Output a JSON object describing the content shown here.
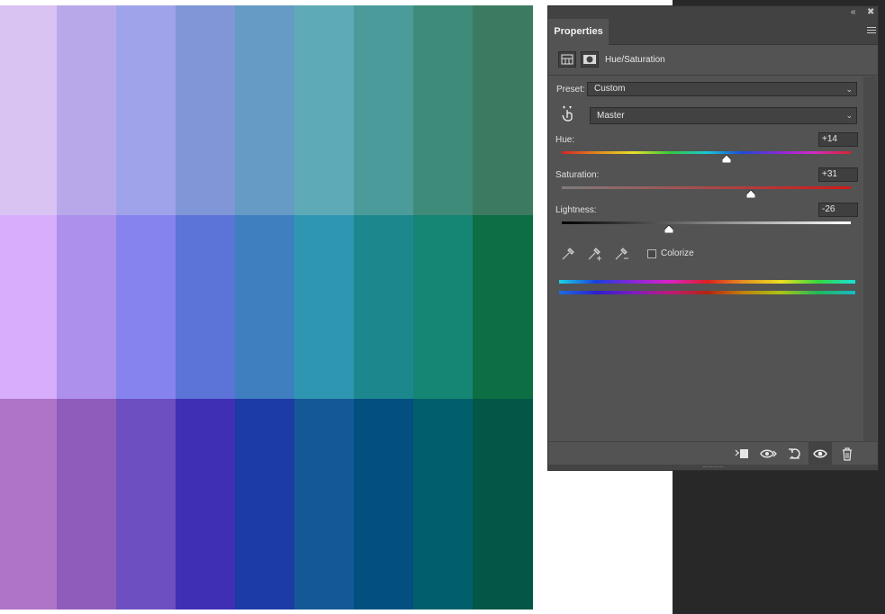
{
  "panel": {
    "tab_label": "Properties",
    "adjustment_title": "Hue/Saturation",
    "preset_label": "Preset:",
    "preset_value": "Custom",
    "channel_value": "Master",
    "hue": {
      "label": "Hue:",
      "value": "+14",
      "position": 0.57
    },
    "saturation": {
      "label": "Saturation:",
      "value": "+31",
      "position": 0.655
    },
    "lightness": {
      "label": "Lightness:",
      "value": "-26",
      "position": 0.37
    },
    "colorize_label": "Colorize",
    "colorize_checked": false
  },
  "icons": {
    "collapse": "double-chevron-left-icon",
    "close": "close-icon",
    "menu": "panel-menu-icon",
    "adjustment_layer": "adjustment-layer-icon",
    "mask": "layer-mask-icon",
    "targeted_adjustment": "targeted-adjustment-hand-icon",
    "eyedropper": "eyedropper-icon",
    "eyedropper_add": "eyedropper-add-icon",
    "eyedropper_subtract": "eyedropper-subtract-icon",
    "clip_to_layer": "clip-to-layer-icon",
    "view_previous": "view-previous-state-icon",
    "reset": "reset-icon",
    "visibility": "eye-icon",
    "delete": "trash-icon"
  },
  "swatches": {
    "columns": 9,
    "rows": [
      [
        "#d9c3f2",
        "#b9a8e9",
        "#9fa4ea",
        "#8096d7",
        "#659bc4",
        "#5eaab6",
        "#4c9b9b",
        "#3f8b79",
        "#3c7b62"
      ],
      [
        "#d7adfc",
        "#ac90ec",
        "#8683ee",
        "#5c73d8",
        "#3f7fc0",
        "#2f96b2",
        "#1d878e",
        "#158674",
        "#0d6e44"
      ],
      [
        "#af74c7",
        "#8f5cbc",
        "#6d4fc1",
        "#3f2fb5",
        "#1c3ba5",
        "#155897",
        "#034f80",
        "#015f6c",
        "#025746"
      ]
    ]
  }
}
